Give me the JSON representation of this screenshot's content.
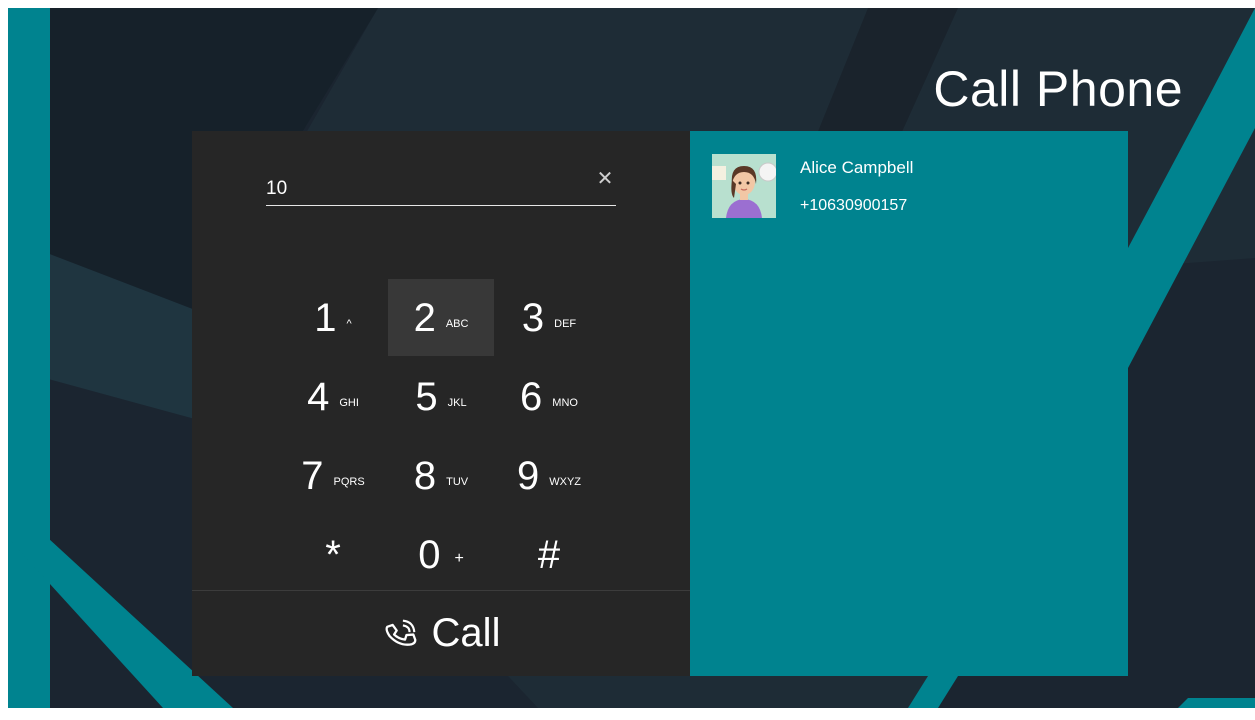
{
  "header": {
    "title": "Call Phone"
  },
  "dialer": {
    "number_value": "10",
    "clear_icon": "close-icon",
    "keys": [
      {
        "digit": "1",
        "letters": "^"
      },
      {
        "digit": "2",
        "letters": "ABC"
      },
      {
        "digit": "3",
        "letters": "DEF"
      },
      {
        "digit": "4",
        "letters": "GHI"
      },
      {
        "digit": "5",
        "letters": "JKL"
      },
      {
        "digit": "6",
        "letters": "MNO"
      },
      {
        "digit": "7",
        "letters": "PQRS"
      },
      {
        "digit": "8",
        "letters": "TUV"
      },
      {
        "digit": "9",
        "letters": "WXYZ"
      },
      {
        "digit": "*",
        "letters": ""
      },
      {
        "digit": "0",
        "letters": "+"
      },
      {
        "digit": "#",
        "letters": ""
      }
    ],
    "call_label": "Call",
    "call_icon": "phone-icon"
  },
  "results": {
    "contacts": [
      {
        "name": "Alice Campbell",
        "number": "+10630900157",
        "avatar_icon": "avatar-woman-icon"
      }
    ]
  },
  "colors": {
    "background": "#1b2530",
    "accent_teal": "#00838f",
    "dialer_bg": "#262626",
    "key_active_bg": "#383838"
  }
}
